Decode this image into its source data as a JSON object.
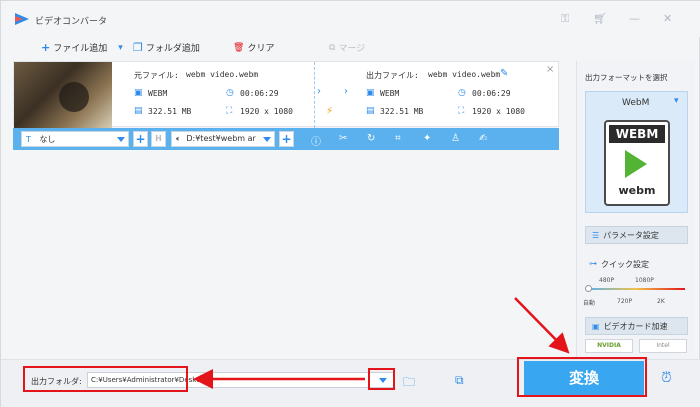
{
  "app": {
    "title": "ビデオコンバータ"
  },
  "toolbar": {
    "add_file": "ファイル追加",
    "add_folder": "フォルダ追加",
    "clear": "クリア",
    "merge": "マージ"
  },
  "file": {
    "source_label": "元ファイル:",
    "source_name": "webm video.webm",
    "source_format": "WEBM",
    "source_duration": "00:06:29",
    "source_size": "322.51 MB",
    "source_resolution": "1920 x 1080",
    "output_label": "出力ファイル:",
    "output_name": "webm video.webm",
    "output_format": "WEBM",
    "output_duration": "00:06:29",
    "output_size": "322.51 MB",
    "output_resolution": "1920 x 1080"
  },
  "editbar": {
    "subtitle_value": "なし",
    "audio_value": "D:¥test¥webm ar"
  },
  "panel": {
    "heading": "出力フォーマットを選択",
    "format_name": "WebM",
    "logo_top": "WEBM",
    "logo_bottom": "webm",
    "params_label": "パラメータ設定",
    "quick_label": "クイック設定",
    "q_480": "480P",
    "q_1080": "1080P",
    "q_auto": "自動",
    "q_720": "720P",
    "q_2k": "2K",
    "gpu_label": "ビデオカード加速",
    "nvidia": "NVIDIA",
    "intel": "Intel"
  },
  "bottom": {
    "folder_label": "出力フォルダ:",
    "folder_path": "C:¥Users¥Administrator¥Desktop",
    "convert_label": "変換"
  },
  "colors": {
    "accent": "#2e8ce8",
    "convert": "#38a6f0",
    "annotation": "#e3151b"
  }
}
